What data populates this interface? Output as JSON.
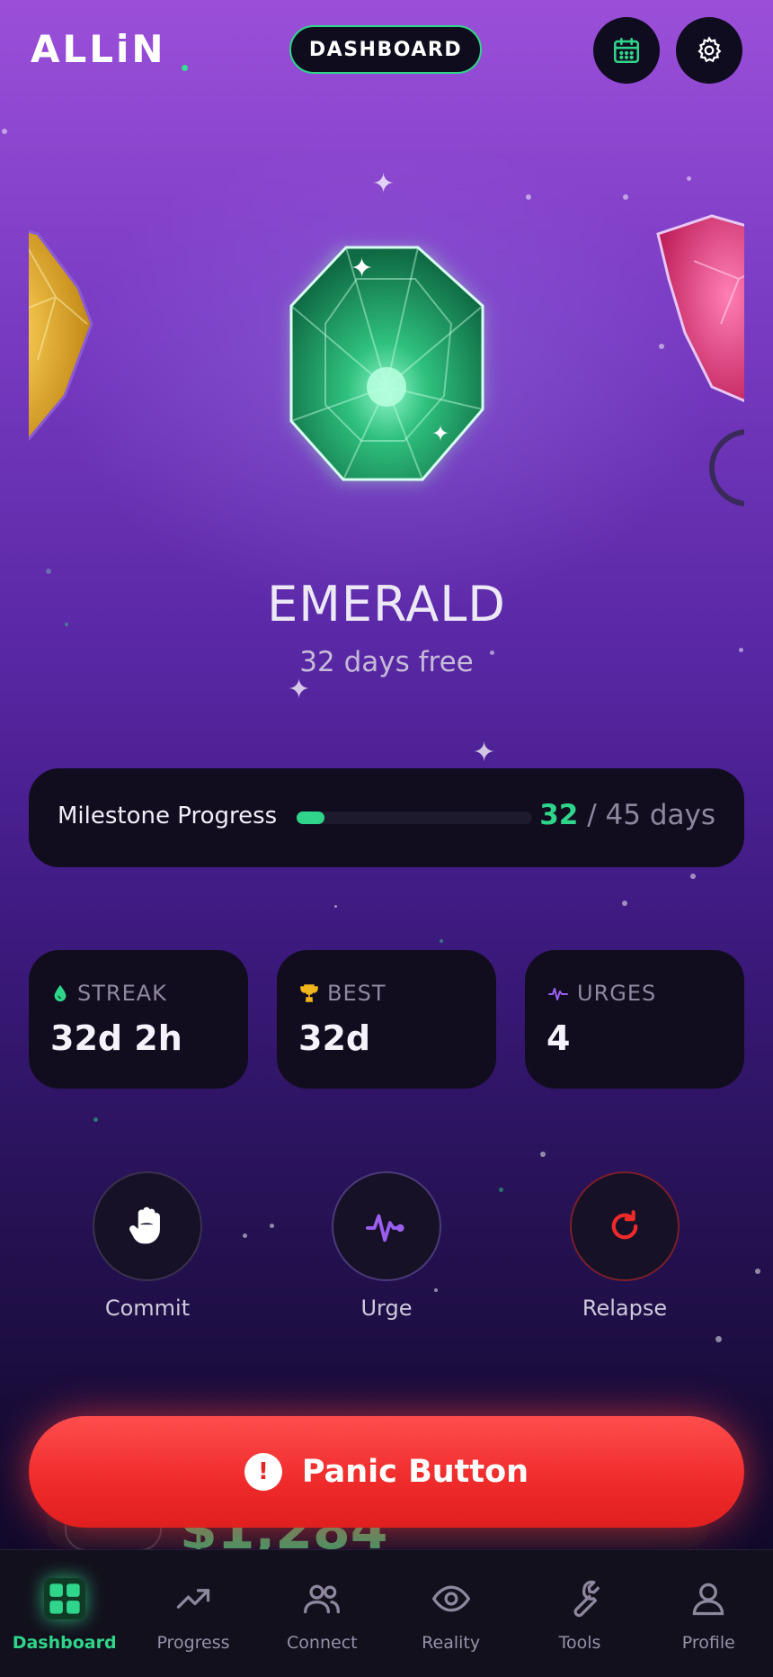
{
  "header": {
    "logo": "ALLiN",
    "center_pill": "DASHBOARD",
    "calendar_icon": "calendar-icon",
    "settings_icon": "gear-icon"
  },
  "gem": {
    "name": "EMERALD",
    "subtitle": "32 days free",
    "carousel": [
      "topaz",
      "emerald",
      "ruby"
    ]
  },
  "milestone": {
    "label": "Milestone Progress",
    "current": "32",
    "target_text": "/ 45 days",
    "progress": 0.12
  },
  "stats": [
    {
      "label": "STREAK",
      "value": "32d 2h",
      "icon": "drop-icon"
    },
    {
      "label": "BEST",
      "value": "32d",
      "icon": "trophy-icon"
    },
    {
      "label": "URGES",
      "value": "4",
      "icon": "pulse-icon"
    }
  ],
  "actions": [
    {
      "label": "Commit",
      "icon": "hand-icon"
    },
    {
      "label": "Urge",
      "icon": "pulse-icon"
    },
    {
      "label": "Relapse",
      "icon": "refresh-icon"
    }
  ],
  "peek": {
    "amount": "$1,284"
  },
  "panic": {
    "label": "Panic Button",
    "icon_glyph": "!"
  },
  "nav": {
    "items": [
      {
        "label": "Dashboard",
        "icon": "grid-icon",
        "active": true
      },
      {
        "label": "Progress",
        "icon": "trend-icon"
      },
      {
        "label": "Connect",
        "icon": "users-icon"
      },
      {
        "label": "Reality",
        "icon": "eye-icon"
      },
      {
        "label": "Tools",
        "icon": "wrench-icon"
      },
      {
        "label": "Profile",
        "icon": "user-icon"
      }
    ]
  },
  "colors": {
    "accent": "#2fd58a",
    "danger": "#ef2a2a",
    "card": "#110d1f",
    "urge": "#9b5ff0"
  }
}
